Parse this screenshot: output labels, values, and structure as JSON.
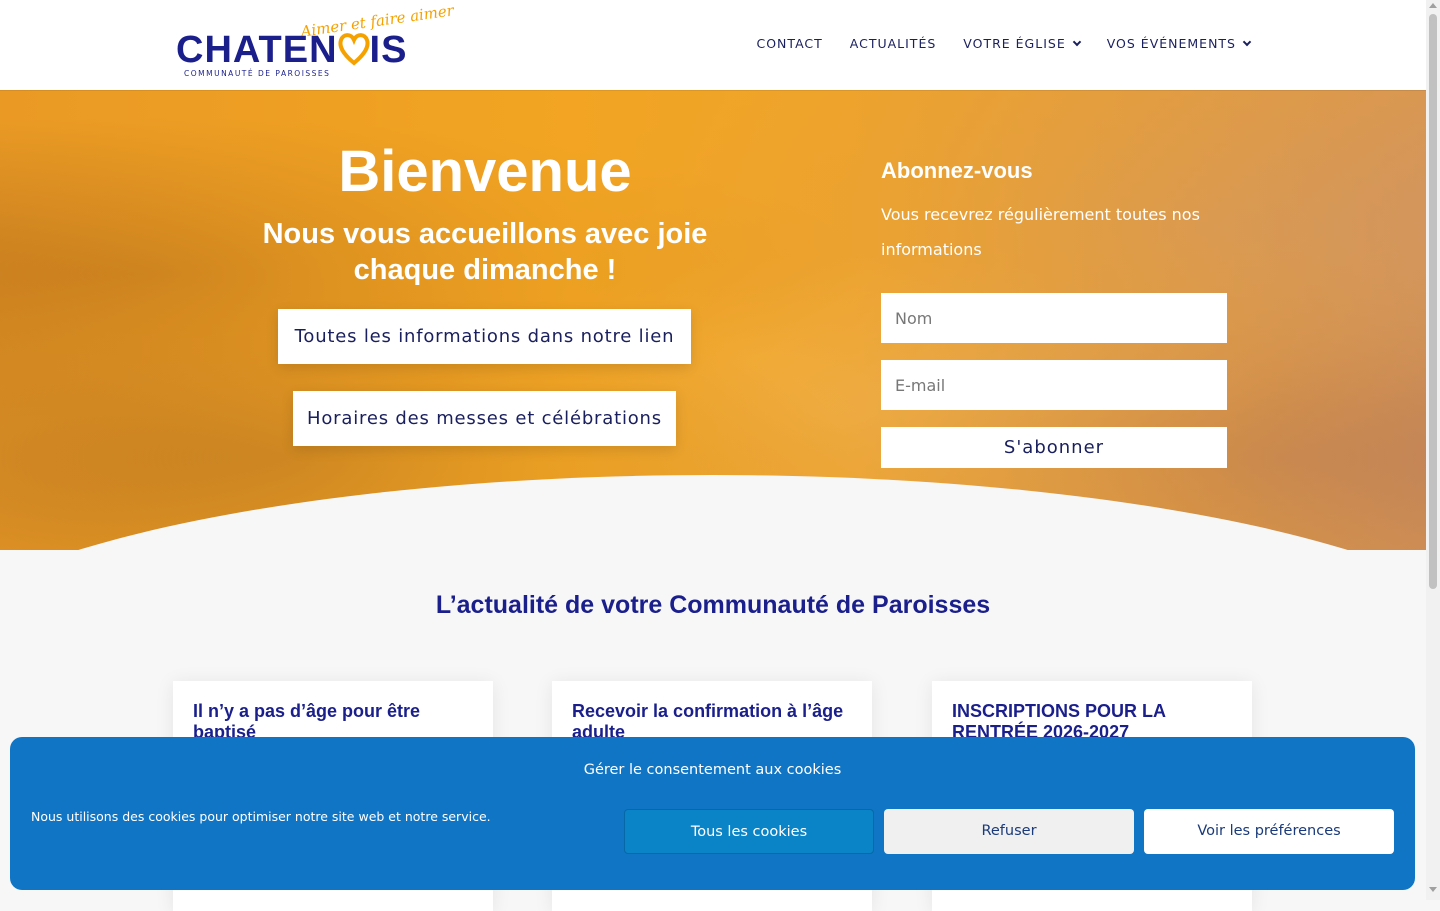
{
  "header": {
    "logo": {
      "tagline": "Aimer et faire aimer",
      "name_start": "CHATEN",
      "name_end": "IS",
      "subtitle": "COMMUNAUTÉ DE PAROISSES"
    },
    "nav": [
      {
        "label": "CONTACT",
        "has_dropdown": false
      },
      {
        "label": "ACTUALITÉS",
        "has_dropdown": false
      },
      {
        "label": "VOTRE ÉGLISE",
        "has_dropdown": true
      },
      {
        "label": "VOS ÉVÉNEMENTS",
        "has_dropdown": true
      }
    ]
  },
  "hero": {
    "title": "Bienvenue",
    "subtitle": "Nous vous accueillons avec joie chaque dimanche !",
    "buttons": [
      "Toutes les informations dans notre lien",
      "Horaires des messes et célébrations"
    ]
  },
  "subscribe": {
    "title": "Abonnez-vous",
    "text": "Vous recevrez régulièrement toutes nos informations",
    "name_placeholder": "Nom",
    "email_placeholder": "E-mail",
    "button": "S'abonner"
  },
  "news": {
    "title": "L’actualité de votre Communauté de Paroisses",
    "cards": [
      {
        "title": "Il n’y a pas d’âge pour être baptisé"
      },
      {
        "title": "Recevoir la confirmation à l’âge adulte"
      },
      {
        "title": "INSCRIPTIONS POUR LA RENTRÉE 2026-2027"
      }
    ]
  },
  "cookie": {
    "title": "Gérer le consentement aux cookies",
    "text": "Nous utilisons des cookies pour optimiser notre site web et notre service.",
    "accept": "Tous les cookies",
    "refuse": "Refuser",
    "preferences": "Voir les préférences"
  },
  "colors": {
    "brand_blue": "#1a1f8c",
    "brand_orange": "#f5a200",
    "cookie_bg": "#1075c4"
  },
  "icons": {
    "dropdown": "chevron-down-icon",
    "logo_heart": "heart-icon"
  }
}
